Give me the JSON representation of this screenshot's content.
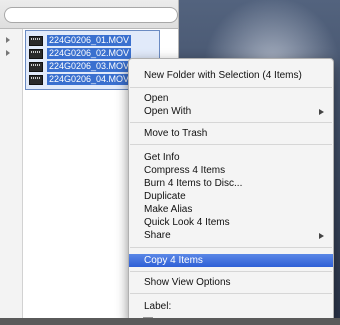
{
  "files": [
    {
      "name": "224G0206_01.MOV"
    },
    {
      "name": "224G0206_02.MOV"
    },
    {
      "name": "224G0206_03.MOV"
    },
    {
      "name": "224G0206_04.MOV"
    }
  ],
  "context_menu": {
    "new_folder": "New Folder with Selection (4 Items)",
    "open": "Open",
    "open_with": "Open With",
    "move_to_trash": "Move to Trash",
    "get_info": "Get Info",
    "compress": "Compress 4 Items",
    "burn": "Burn 4 Items to Disc...",
    "duplicate": "Duplicate",
    "make_alias": "Make Alias",
    "quick_look": "Quick Look 4 Items",
    "share": "Share",
    "copy": "Copy 4 Items",
    "show_view_options": "Show View Options",
    "label": "Label:"
  },
  "label_colors": [
    "#f08a8a",
    "#f3b36b",
    "#f2e36f",
    "#9ed87f",
    "#8ab8f0",
    "#c79be3",
    "#bdbdbd"
  ],
  "colors": {
    "highlight": "#2e5fd6",
    "file_selection": "#3a70cf"
  }
}
